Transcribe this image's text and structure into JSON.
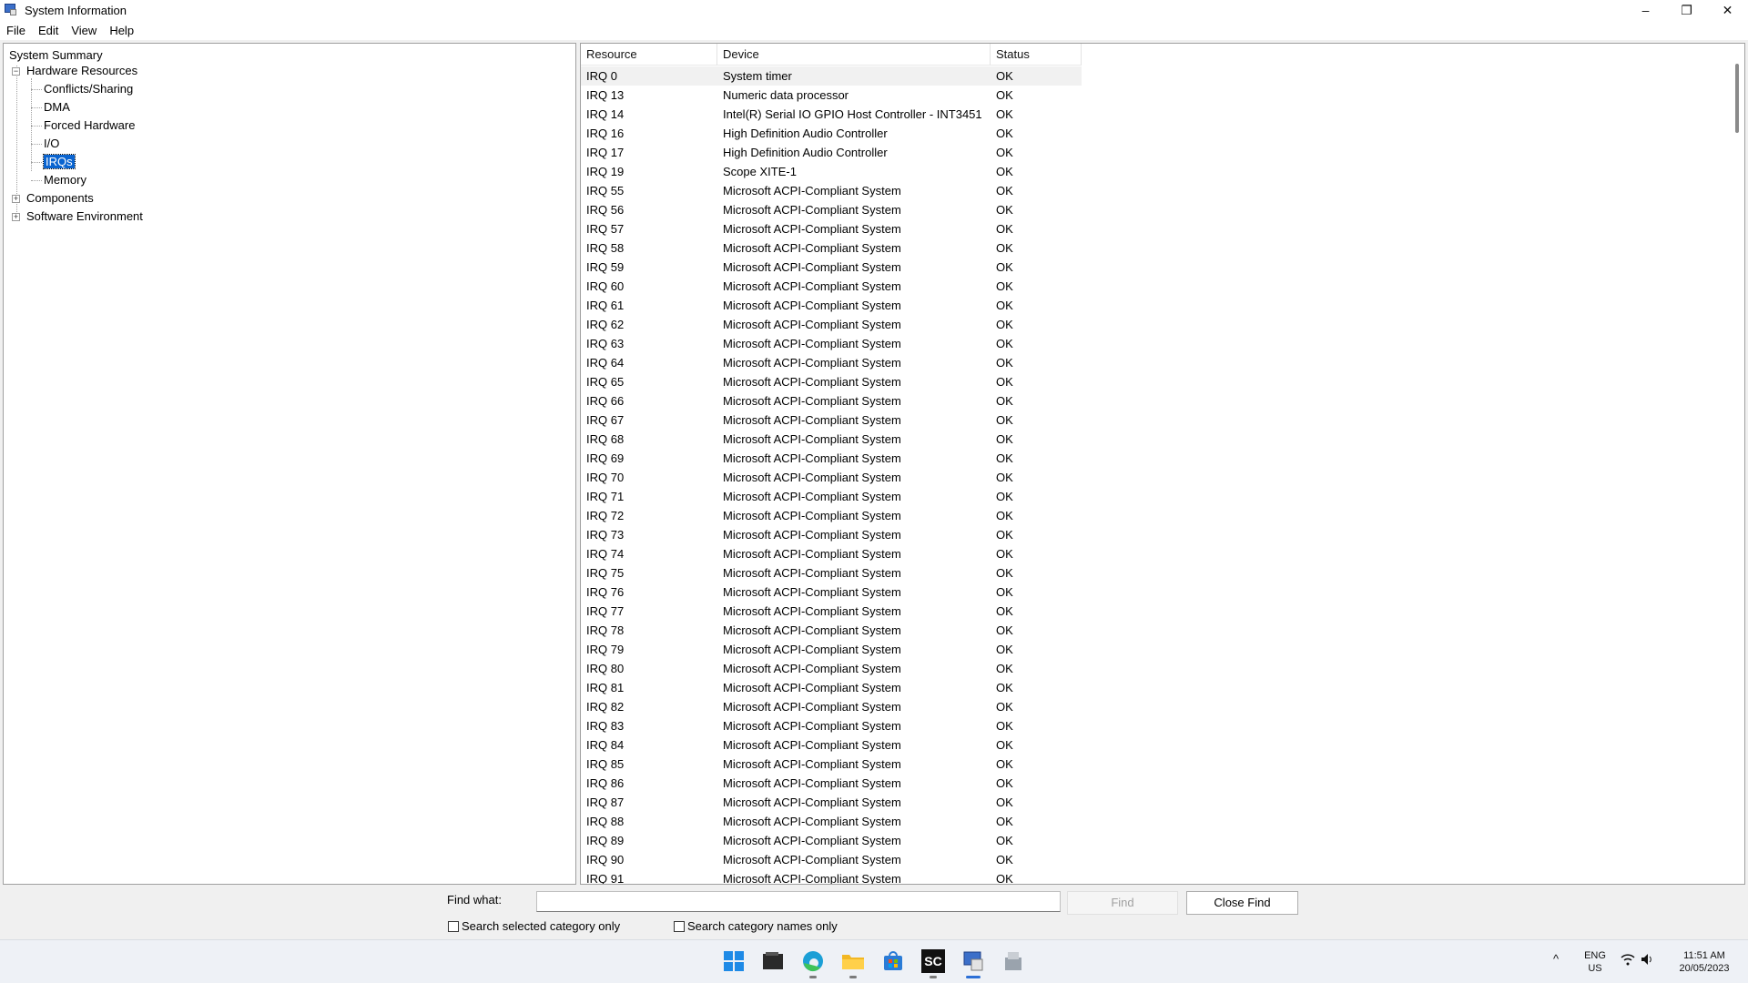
{
  "window": {
    "title": "System Information",
    "minimize": "–",
    "maximize": "❐",
    "close": "✕"
  },
  "menu": [
    "File",
    "Edit",
    "View",
    "Help"
  ],
  "tree": {
    "root": "System Summary",
    "hardware": "Hardware Resources",
    "children": [
      "Conflicts/Sharing",
      "DMA",
      "Forced Hardware",
      "I/O",
      "IRQs",
      "Memory"
    ],
    "selected": "IRQs",
    "components": "Components",
    "software": "Software Environment",
    "expander_plus": "+",
    "expander_minus": "−"
  },
  "list": {
    "columns": [
      "Resource",
      "Device",
      "Status"
    ],
    "rows": [
      [
        "IRQ 0",
        "System timer",
        "OK"
      ],
      [
        "IRQ 13",
        "Numeric data processor",
        "OK"
      ],
      [
        "IRQ 14",
        "Intel(R) Serial IO GPIO Host Controller - INT3451",
        "OK"
      ],
      [
        "IRQ 16",
        "High Definition Audio Controller",
        "OK"
      ],
      [
        "IRQ 17",
        "High Definition Audio Controller",
        "OK"
      ],
      [
        "IRQ 19",
        "Scope XITE-1",
        "OK"
      ],
      [
        "IRQ 55",
        "Microsoft ACPI-Compliant System",
        "OK"
      ],
      [
        "IRQ 56",
        "Microsoft ACPI-Compliant System",
        "OK"
      ],
      [
        "IRQ 57",
        "Microsoft ACPI-Compliant System",
        "OK"
      ],
      [
        "IRQ 58",
        "Microsoft ACPI-Compliant System",
        "OK"
      ],
      [
        "IRQ 59",
        "Microsoft ACPI-Compliant System",
        "OK"
      ],
      [
        "IRQ 60",
        "Microsoft ACPI-Compliant System",
        "OK"
      ],
      [
        "IRQ 61",
        "Microsoft ACPI-Compliant System",
        "OK"
      ],
      [
        "IRQ 62",
        "Microsoft ACPI-Compliant System",
        "OK"
      ],
      [
        "IRQ 63",
        "Microsoft ACPI-Compliant System",
        "OK"
      ],
      [
        "IRQ 64",
        "Microsoft ACPI-Compliant System",
        "OK"
      ],
      [
        "IRQ 65",
        "Microsoft ACPI-Compliant System",
        "OK"
      ],
      [
        "IRQ 66",
        "Microsoft ACPI-Compliant System",
        "OK"
      ],
      [
        "IRQ 67",
        "Microsoft ACPI-Compliant System",
        "OK"
      ],
      [
        "IRQ 68",
        "Microsoft ACPI-Compliant System",
        "OK"
      ],
      [
        "IRQ 69",
        "Microsoft ACPI-Compliant System",
        "OK"
      ],
      [
        "IRQ 70",
        "Microsoft ACPI-Compliant System",
        "OK"
      ],
      [
        "IRQ 71",
        "Microsoft ACPI-Compliant System",
        "OK"
      ],
      [
        "IRQ 72",
        "Microsoft ACPI-Compliant System",
        "OK"
      ],
      [
        "IRQ 73",
        "Microsoft ACPI-Compliant System",
        "OK"
      ],
      [
        "IRQ 74",
        "Microsoft ACPI-Compliant System",
        "OK"
      ],
      [
        "IRQ 75",
        "Microsoft ACPI-Compliant System",
        "OK"
      ],
      [
        "IRQ 76",
        "Microsoft ACPI-Compliant System",
        "OK"
      ],
      [
        "IRQ 77",
        "Microsoft ACPI-Compliant System",
        "OK"
      ],
      [
        "IRQ 78",
        "Microsoft ACPI-Compliant System",
        "OK"
      ],
      [
        "IRQ 79",
        "Microsoft ACPI-Compliant System",
        "OK"
      ],
      [
        "IRQ 80",
        "Microsoft ACPI-Compliant System",
        "OK"
      ],
      [
        "IRQ 81",
        "Microsoft ACPI-Compliant System",
        "OK"
      ],
      [
        "IRQ 82",
        "Microsoft ACPI-Compliant System",
        "OK"
      ],
      [
        "IRQ 83",
        "Microsoft ACPI-Compliant System",
        "OK"
      ],
      [
        "IRQ 84",
        "Microsoft ACPI-Compliant System",
        "OK"
      ],
      [
        "IRQ 85",
        "Microsoft ACPI-Compliant System",
        "OK"
      ],
      [
        "IRQ 86",
        "Microsoft ACPI-Compliant System",
        "OK"
      ],
      [
        "IRQ 87",
        "Microsoft ACPI-Compliant System",
        "OK"
      ],
      [
        "IRQ 88",
        "Microsoft ACPI-Compliant System",
        "OK"
      ],
      [
        "IRQ 89",
        "Microsoft ACPI-Compliant System",
        "OK"
      ],
      [
        "IRQ 90",
        "Microsoft ACPI-Compliant System",
        "OK"
      ],
      [
        "IRQ 91",
        "Microsoft ACPI-Compliant System",
        "OK"
      ]
    ]
  },
  "find": {
    "label": "Find what:",
    "value": "",
    "placeholder": "",
    "find_button": "Find",
    "close_button": "Close Find",
    "check_selected": "Search selected category only",
    "check_names": "Search category names only"
  },
  "taskbar": {
    "apps": [
      "start-icon",
      "terminal-icon",
      "edge-icon",
      "file-explorer-icon",
      "store-icon",
      "sc-app-icon",
      "system-information-icon",
      "app-installer-icon"
    ],
    "sc_label": "SC",
    "chevron": "^",
    "lang_top": "ENG",
    "lang_bottom": "US",
    "time": "11:51 AM",
    "date": "20/05/2023"
  },
  "colors": {
    "selection": "#0a64d0",
    "accent": "#2b6fd6"
  }
}
